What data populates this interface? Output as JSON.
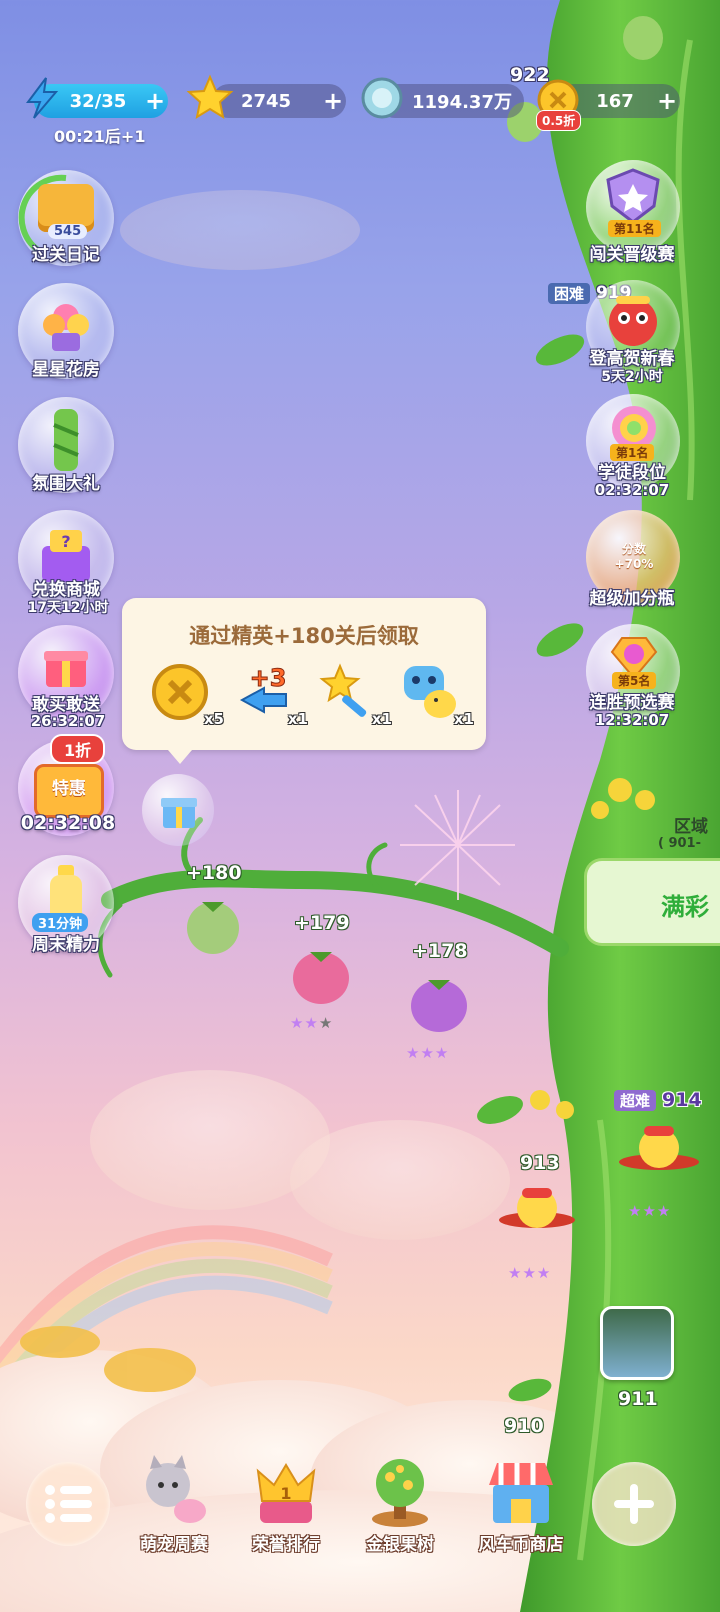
{
  "resources": {
    "energy": {
      "value": "32/35",
      "timer": "00:21后+1",
      "icon": "lightning-icon"
    },
    "stars": {
      "value": "2745",
      "icon": "star-icon"
    },
    "coins": {
      "value": "1194.37万",
      "icon": "silver-coin-icon"
    },
    "gold": {
      "value": "167",
      "above": "922",
      "discount": "0.5折",
      "icon": "gold-coin-icon"
    }
  },
  "left_menu": [
    {
      "label": "过关日记",
      "badge": "545"
    },
    {
      "label": "星星花房"
    },
    {
      "label": "氛围大礼"
    },
    {
      "label": "兑换商城",
      "sub": "17天12小时"
    },
    {
      "label": "敢买敢送",
      "sub": "26:32:07"
    },
    {
      "label": "特惠",
      "badge": "1折",
      "sub": "02:32:08"
    },
    {
      "label": "周末精力",
      "badge": "31分钟"
    }
  ],
  "right_menu": [
    {
      "label": "闯关晋级赛",
      "badge": "第11名"
    },
    {
      "label": "登高贺新春",
      "sub": "5天2小时",
      "tag": "困难",
      "tag_level": "919"
    },
    {
      "label": "学徒段位",
      "badge": "第1名",
      "sub": "02:32:07"
    },
    {
      "label": "超级加分瓶",
      "badge": "分数 +70%"
    },
    {
      "label": "连胜预选赛",
      "badge": "第5名",
      "sub": "12:32:07"
    }
  ],
  "tooltip": {
    "title": "通过精英+180关后领取",
    "items": [
      {
        "icon": "gold-coin-icon",
        "count": "x5"
      },
      {
        "icon": "plus3-moves-icon",
        "count": "x1",
        "text": "+3"
      },
      {
        "icon": "magic-wand-icon",
        "count": "x1"
      },
      {
        "icon": "pet-chick-icon",
        "count": "x1"
      }
    ]
  },
  "elite_levels": [
    {
      "label": "+180",
      "stars": 0
    },
    {
      "label": "+179",
      "stars": 2
    },
    {
      "label": "+178",
      "stars": 3
    }
  ],
  "map_levels": [
    {
      "label": "913",
      "stars": 3
    },
    {
      "label": "914",
      "tag": "超难",
      "stars": 3
    },
    {
      "label": "911"
    },
    {
      "label": "910"
    }
  ],
  "region": {
    "label": "区域",
    "range": "( 901-",
    "banner": "满彩"
  },
  "bottom_nav": [
    {
      "label": "萌宠周赛",
      "icon": "cat-pet-icon"
    },
    {
      "label": "荣誉排行",
      "icon": "crown-icon",
      "badge": "1"
    },
    {
      "label": "金银果树",
      "icon": "money-tree-icon"
    },
    {
      "label": "风车币商店",
      "icon": "shop-icon"
    }
  ],
  "colors": {
    "vine": "#4fae3a",
    "accent_red": "#e8413c",
    "gold": "#f6b21c"
  }
}
